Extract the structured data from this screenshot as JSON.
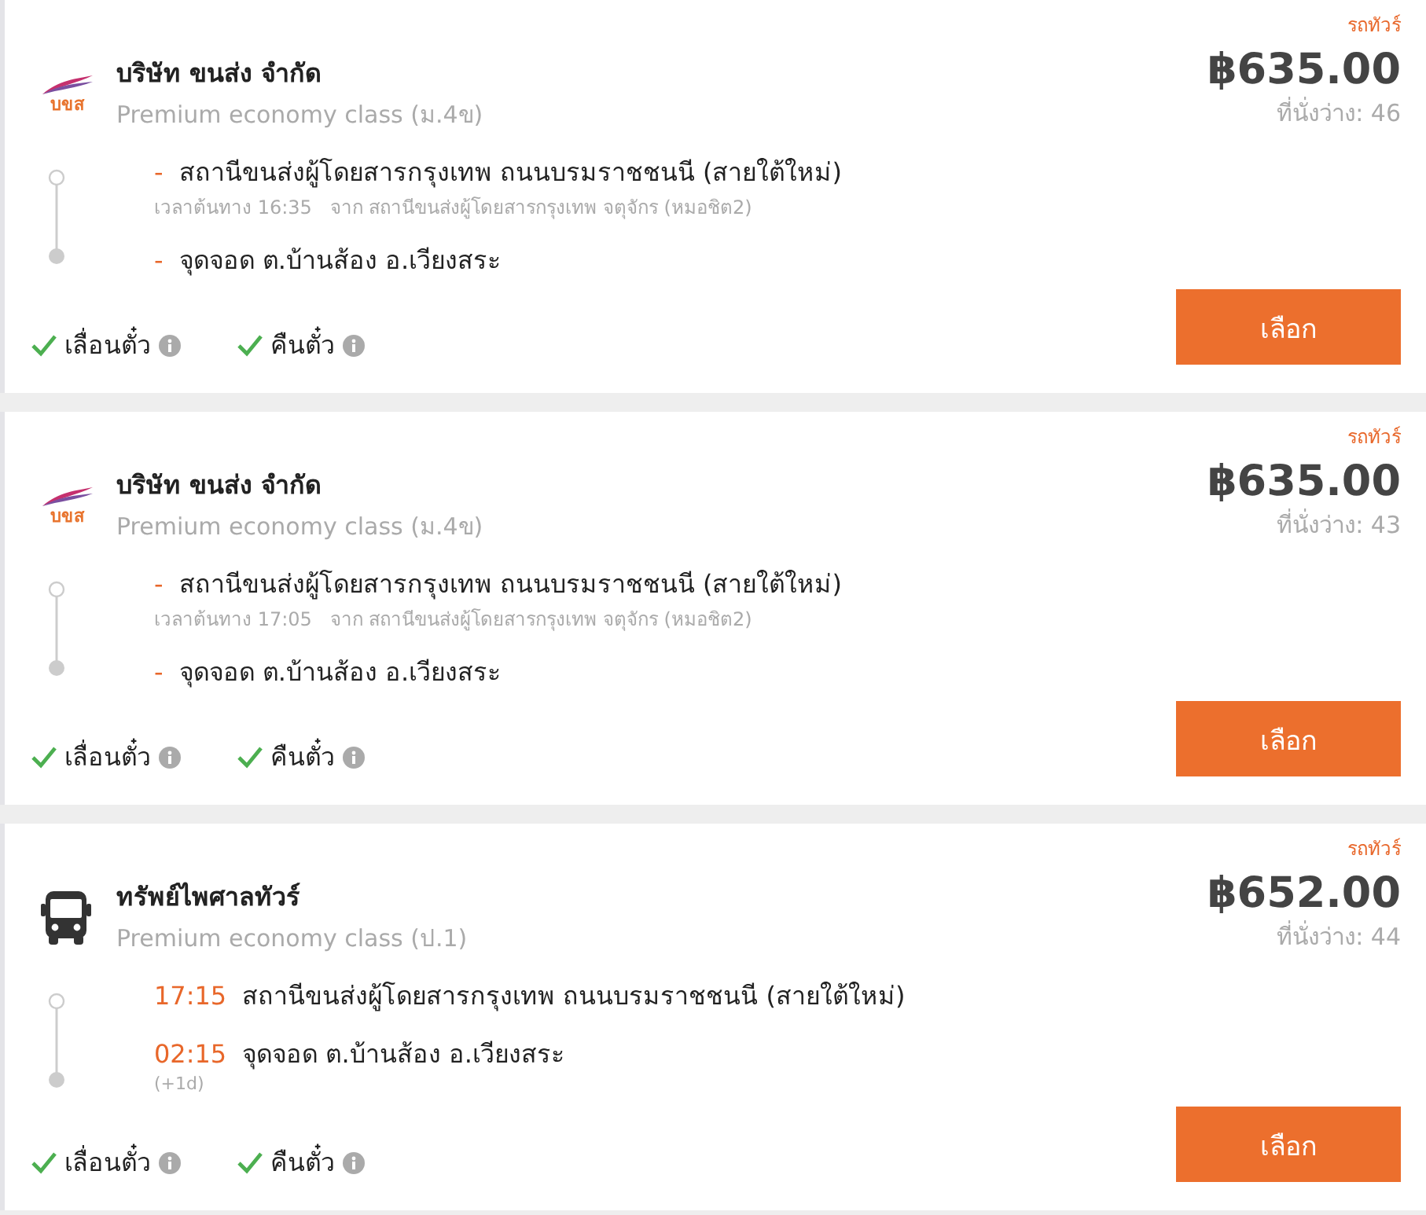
{
  "trips": [
    {
      "logo": {
        "kind": "brand",
        "text": "บขส"
      },
      "operator": "บริษัท ขนส่ง จำกัด",
      "class": "Premium economy class (ม.4ข)",
      "tag": "รถทัวร์",
      "price": "฿635.00",
      "seats": "ที่นั่งว่าง: 46",
      "stops": [
        {
          "marker": "-",
          "place": "สถานีขนส่งผู้โดยสารกรุงเทพ ถนนบรมราชชนนี (สายใต้ใหม่)",
          "detail": "เวลาต้นทาง 16:35   จาก สถานีขนส่งผู้โดยสารกรุงเทพ จตุจักร (หมอชิต2)"
        },
        {
          "marker": "-",
          "place": "จุดจอด ต.บ้านส้อง อ.เวียงสระ"
        }
      ],
      "features": [
        {
          "label": "เลื่อนตั๋ว",
          "checked": true
        },
        {
          "label": "คืนตั๋ว",
          "checked": true
        }
      ],
      "button": "เลือก"
    },
    {
      "logo": {
        "kind": "brand",
        "text": "บขส"
      },
      "operator": "บริษัท ขนส่ง จำกัด",
      "class": "Premium economy class (ม.4ข)",
      "tag": "รถทัวร์",
      "price": "฿635.00",
      "seats": "ที่นั่งว่าง: 43",
      "stops": [
        {
          "marker": "-",
          "place": "สถานีขนส่งผู้โดยสารกรุงเทพ ถนนบรมราชชนนี (สายใต้ใหม่)",
          "detail": "เวลาต้นทาง 17:05   จาก สถานีขนส่งผู้โดยสารกรุงเทพ จตุจักร (หมอชิต2)"
        },
        {
          "marker": "-",
          "place": "จุดจอด ต.บ้านส้อง อ.เวียงสระ"
        }
      ],
      "features": [
        {
          "label": "เลื่อนตั๋ว",
          "checked": true
        },
        {
          "label": "คืนตั๋ว",
          "checked": true
        }
      ],
      "button": "เลือก"
    },
    {
      "logo": {
        "kind": "bus"
      },
      "operator": "ทรัพย์ไพศาลทัวร์",
      "class": "Premium economy class (ป.1)",
      "tag": "รถทัวร์",
      "price": "฿652.00",
      "seats": "ที่นั่งว่าง: 44",
      "stops": [
        {
          "marker": "17:15",
          "place": "สถานีขนส่งผู้โดยสารกรุงเทพ ถนนบรมราชชนนี (สายใต้ใหม่)"
        },
        {
          "marker": "02:15",
          "place": "จุดจอด ต.บ้านส้อง อ.เวียงสระ",
          "note": "(+1d)"
        }
      ],
      "features": [
        {
          "label": "เลื่อนตั๋ว",
          "checked": true
        },
        {
          "label": "คืนตั๋ว",
          "checked": true
        }
      ],
      "button": "เลือก"
    }
  ]
}
